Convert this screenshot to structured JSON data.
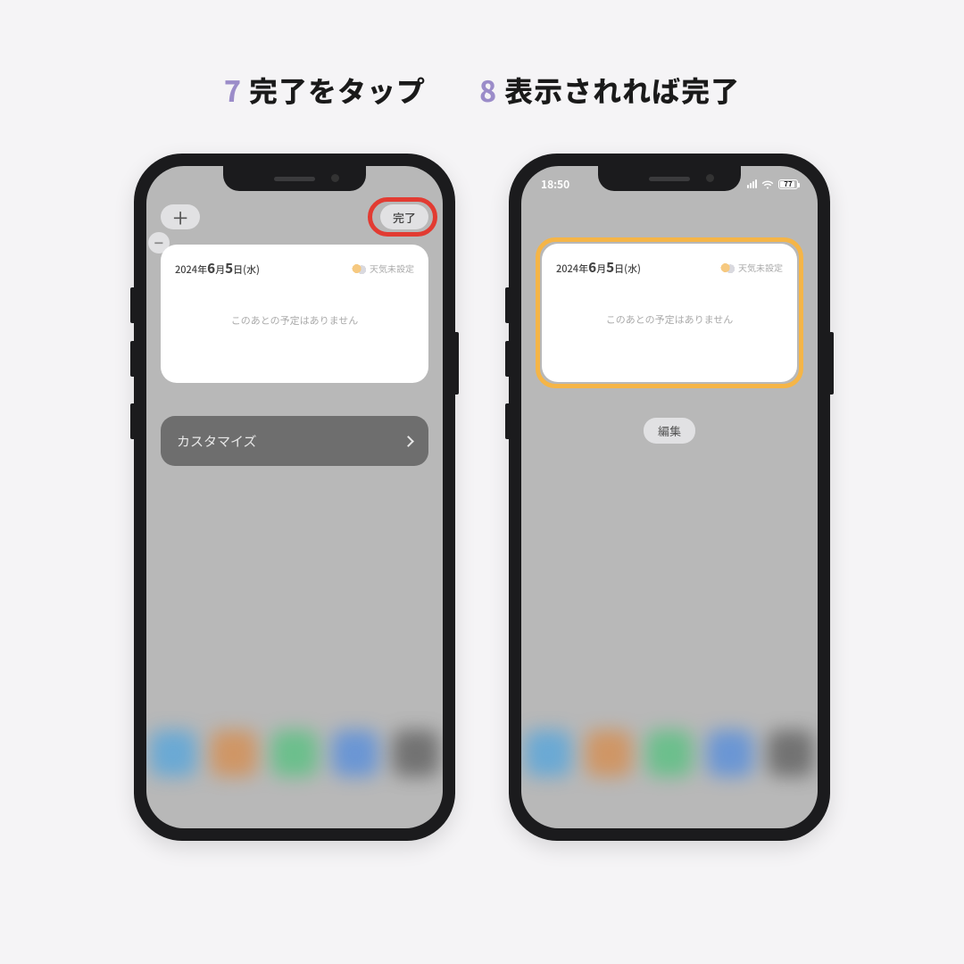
{
  "step7": {
    "num": "7",
    "title": "完了をタップ",
    "add_label": "＋",
    "done_label": "完了",
    "minus_label": "−",
    "widget": {
      "date_prefix": "2024年",
      "date_month": "6",
      "date_sep1": "月",
      "date_day": "5",
      "date_sep2": "日",
      "date_wday": "(水)",
      "weather_label": "天気未設定",
      "empty_msg": "このあとの予定はありません"
    },
    "customize_label": "カスタマイズ"
  },
  "step8": {
    "num": "8",
    "title": "表示されれば完了",
    "status_time": "18:50",
    "battery": "77",
    "widget": {
      "date_prefix": "2024年",
      "date_month": "6",
      "date_sep1": "月",
      "date_day": "5",
      "date_sep2": "日",
      "date_wday": "(水)",
      "weather_label": "天気未設定",
      "empty_msg": "このあとの予定はありません"
    },
    "edit_label": "編集"
  },
  "dock_colors": [
    "#4aa3e0",
    "#d98843",
    "#4cc27a",
    "#4a88e0",
    "#555"
  ]
}
